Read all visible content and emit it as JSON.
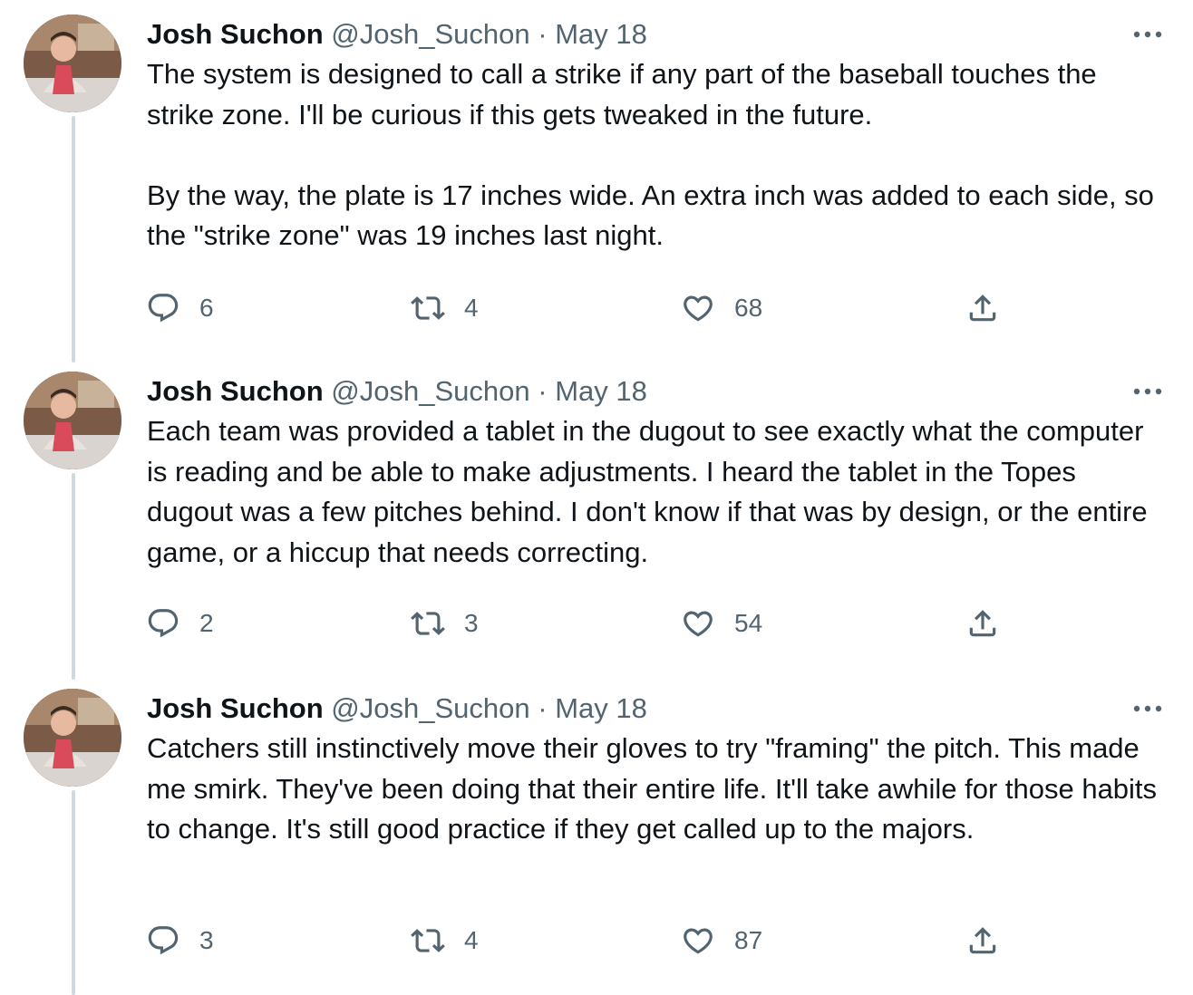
{
  "tweets": [
    {
      "author": "Josh Suchon",
      "handle": "@Josh_Suchon",
      "separator": "·",
      "date": "May 18",
      "text": "The system is designed to call a strike if any part of the baseball touches the strike zone. I'll be curious if this gets tweaked in the future.\n\nBy the way, the plate is 17 inches wide. An extra inch was added to each side, so the \"strike zone\" was 19 inches last night.",
      "replies": "6",
      "retweets": "4",
      "likes": "68"
    },
    {
      "author": "Josh Suchon",
      "handle": "@Josh_Suchon",
      "separator": "·",
      "date": "May 18",
      "text": "Each team was provided a tablet in the dugout to see exactly what the computer is reading and be able to make adjustments. I heard the tablet in the Topes dugout was a few pitches behind. I don't know if that was by design, or the entire game, or a hiccup that needs correcting.",
      "replies": "2",
      "retweets": "3",
      "likes": "54"
    },
    {
      "author": "Josh Suchon",
      "handle": "@Josh_Suchon",
      "separator": "·",
      "date": "May 18",
      "text": "Catchers still instinctively move their gloves to try \"framing\" the pitch. This made me smirk. They've been doing that their entire life. It'll take awhile for those habits to change. It's still good practice if they get called up to the majors.",
      "replies": "3",
      "retweets": "4",
      "likes": "87"
    }
  ],
  "icons": {
    "reply": "reply-icon",
    "retweet": "retweet-icon",
    "like": "heart-icon",
    "share": "share-icon",
    "more": "more-icon"
  },
  "colors": {
    "text": "#0f1419",
    "secondary": "#536471",
    "thread_line": "#cfd9de"
  }
}
